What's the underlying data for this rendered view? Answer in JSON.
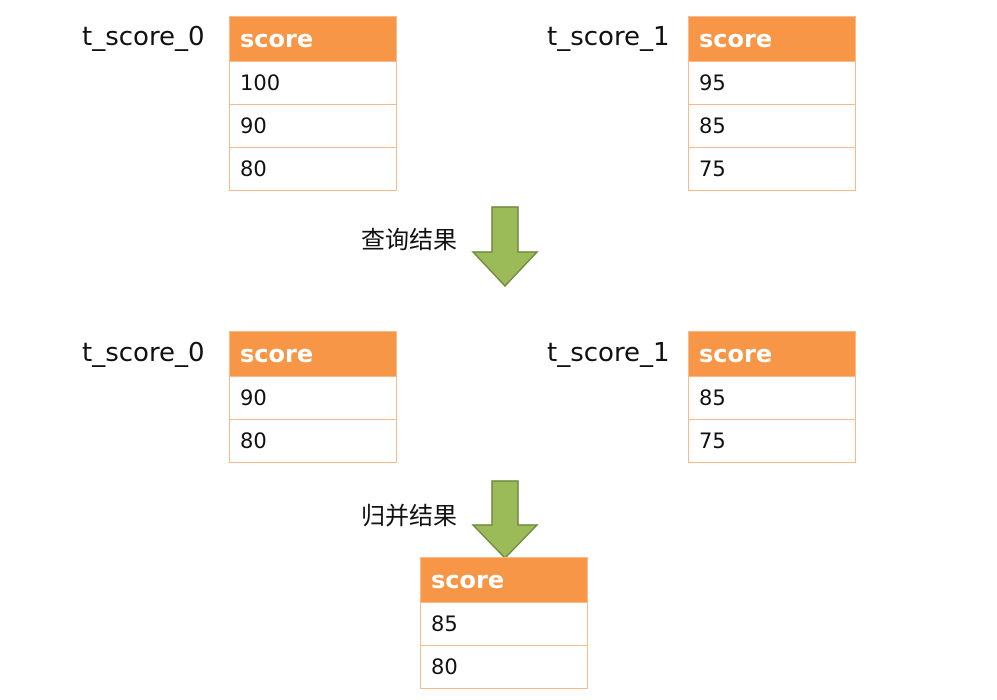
{
  "colors": {
    "header": "#F79646",
    "border": "#F9B98A",
    "arrow": "#9BBB59"
  },
  "top": {
    "left": {
      "label": "t_score_0",
      "header": "score",
      "rows": [
        "100",
        "90",
        "80"
      ]
    },
    "right": {
      "label": "t_score_1",
      "header": "score",
      "rows": [
        "95",
        "85",
        "75"
      ]
    }
  },
  "arrow1": {
    "label": "查询结果",
    "icon": "down-arrow-icon"
  },
  "middle": {
    "left": {
      "label": "t_score_0",
      "header": "score",
      "rows": [
        "90",
        "80"
      ]
    },
    "right": {
      "label": "t_score_1",
      "header": "score",
      "rows": [
        "85",
        "75"
      ]
    }
  },
  "arrow2": {
    "label": "归并结果",
    "icon": "down-arrow-icon"
  },
  "result": {
    "header": "score",
    "rows": [
      "85",
      "80"
    ]
  }
}
